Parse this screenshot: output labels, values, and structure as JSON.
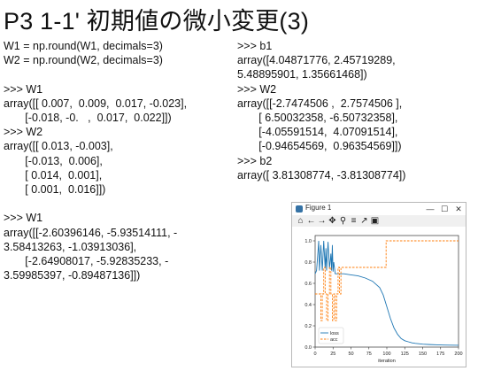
{
  "title": "P3 1-1' 初期値の微小変更(3)",
  "left_code": [
    "W1 = np.round(W1, decimals=3)",
    "W2 = np.round(W2, decimals=3)",
    "",
    ">>> W1",
    "array([[ 0.007,  0.009,  0.017, -0.023],",
    "       [-0.018, -0.   ,  0.017,  0.022]])",
    ">>> W2",
    "array([[ 0.013, -0.003],",
    "       [-0.013,  0.006],",
    "       [ 0.014,  0.001],",
    "       [ 0.001,  0.016]])",
    "",
    ">>> W1",
    "array([[-2.60396146, -5.93514111, -",
    "3.58413263, -1.03913036],",
    "       [-2.64908017, -5.92835233, -",
    "3.59985397, -0.89487136]])"
  ],
  "right_code": [
    ">>> b1",
    "array([4.04871776, 2.45719289,",
    "5.48895901, 1.35661468])",
    ">>> W2",
    "array([[-2.7474506 ,  2.7574506 ],",
    "       [ 6.50032358, -6.50732358],",
    "       [-4.05591514,  4.07091514],",
    "       [-0.94654569,  0.96354569]])",
    ">>> b2",
    "array([ 3.81308774, -3.81308774])"
  ],
  "figure_window": {
    "title": "Figure 1",
    "toolbar_icons": [
      "home-icon",
      "back-icon",
      "forward-icon",
      "pan-icon",
      "zoom-icon",
      "configure-icon",
      "edit-axis-icon",
      "save-icon"
    ],
    "toolbar_glyphs": [
      "⌂",
      "←",
      "→",
      "✥",
      "⚲",
      "≡",
      "↗",
      "▣"
    ],
    "win_buttons": [
      "—",
      "☐",
      "✕"
    ]
  },
  "chart_data": {
    "type": "line",
    "xlabel": "iteration",
    "ylabel": "",
    "xlim": [
      0,
      200
    ],
    "ylim": [
      0,
      1.05
    ],
    "xticks": [
      0,
      25,
      50,
      75,
      100,
      125,
      150,
      175,
      200
    ],
    "yticks": [
      0.0,
      0.2,
      0.4,
      0.6,
      0.8,
      1.0
    ],
    "ytick_labels": [
      "0.0",
      "0.2",
      "0.4",
      "0.6",
      "0.8",
      "1.0"
    ],
    "legend_position": "bottom-left",
    "series": [
      {
        "name": "loss",
        "color": "#1f77b4",
        "style": "solid",
        "x": [
          0,
          2,
          4,
          5,
          6,
          8,
          10,
          12,
          14,
          15,
          16,
          18,
          20,
          22,
          23,
          24,
          25,
          26,
          28,
          30,
          35,
          40,
          50,
          60,
          70,
          80,
          90,
          95,
          100,
          105,
          110,
          115,
          120,
          125,
          130,
          135,
          140,
          150,
          160,
          170,
          180,
          190,
          200
        ],
        "y": [
          0.69,
          0.72,
          0.9,
          1.0,
          0.72,
          0.96,
          0.72,
          1.0,
          0.74,
          0.93,
          0.72,
          0.99,
          0.74,
          0.88,
          0.72,
          0.96,
          0.71,
          0.8,
          0.69,
          0.69,
          0.69,
          0.69,
          0.68,
          0.67,
          0.65,
          0.62,
          0.56,
          0.49,
          0.38,
          0.27,
          0.18,
          0.12,
          0.08,
          0.06,
          0.05,
          0.04,
          0.035,
          0.028,
          0.024,
          0.021,
          0.019,
          0.018,
          0.017
        ]
      },
      {
        "name": "acc",
        "color": "#ff7f0e",
        "style": "dashed",
        "x": [
          0,
          8,
          8,
          10,
          10,
          12,
          12,
          14,
          14,
          16,
          16,
          18,
          18,
          20,
          20,
          22,
          22,
          24,
          24,
          26,
          26,
          28,
          28,
          30,
          30,
          32,
          32,
          34,
          34,
          36,
          36,
          99,
          99,
          200
        ],
        "y": [
          0.5,
          0.5,
          0.25,
          0.25,
          0.5,
          0.5,
          0.75,
          0.75,
          0.5,
          0.5,
          0.25,
          0.25,
          0.5,
          0.5,
          0.75,
          0.75,
          0.5,
          0.5,
          0.25,
          0.25,
          0.5,
          0.5,
          0.25,
          0.25,
          0.5,
          0.5,
          0.75,
          0.75,
          0.5,
          0.5,
          0.75,
          0.75,
          1.0,
          1.0
        ]
      }
    ]
  }
}
